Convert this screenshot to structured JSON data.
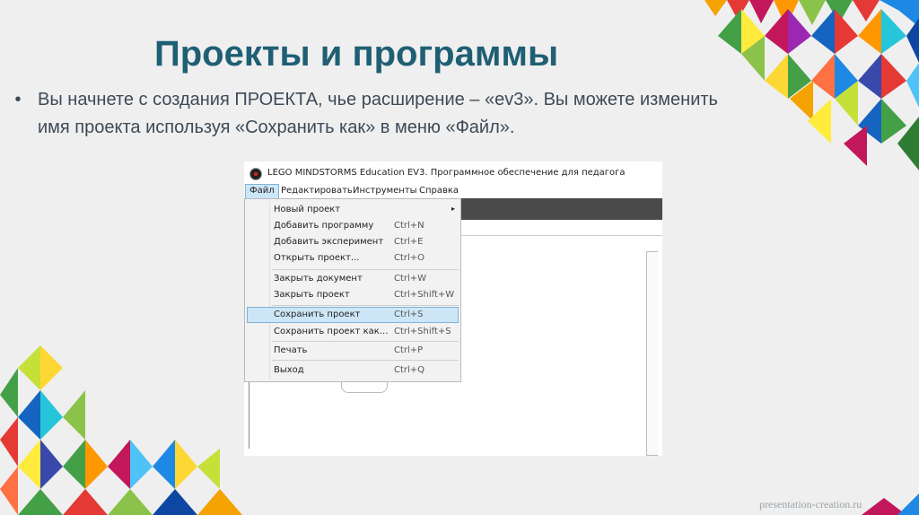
{
  "slide": {
    "title": "Проекты и программы",
    "bullet_marker": "•",
    "bullet_text": "Вы начнете с создания ПРОЕКТА, чье расширение – «ev3». Вы можете изменить имя проекта используя «Сохранить как» в меню «Файл».",
    "watermark": "presentation-creation.ru"
  },
  "screenshot": {
    "window_title": "LEGO MINDSTORMS Education EV3. Программное обеспечение для педагога",
    "menu": [
      {
        "label": "Файл",
        "active": true
      },
      {
        "label": "Редактировать",
        "active": false
      },
      {
        "label": "Инструменты",
        "active": false
      },
      {
        "label": "Справка",
        "active": false
      }
    ],
    "file_menu": [
      {
        "label": "Новый проект",
        "shortcut": "",
        "submenu": true
      },
      {
        "label": "Добавить программу",
        "shortcut": "Ctrl+N"
      },
      {
        "label": "Добавить эксперимент",
        "shortcut": "Ctrl+E"
      },
      {
        "label": "Открыть проект...",
        "shortcut": "Ctrl+O"
      },
      {
        "label": "Закрыть документ",
        "shortcut": "Ctrl+W"
      },
      {
        "label": "Закрыть проект",
        "shortcut": "Ctrl+Shift+W"
      },
      {
        "label": "Сохранить проект",
        "shortcut": "Ctrl+S",
        "highlighted": true
      },
      {
        "label": "Сохранить проект как...",
        "shortcut": "Ctrl+Shift+S"
      },
      {
        "label": "Печать",
        "shortcut": "Ctrl+P"
      },
      {
        "label": "Выход",
        "shortcut": "Ctrl+Q"
      }
    ],
    "submenu_arrow": "▸"
  },
  "colors": {
    "title": "#1f5f74",
    "menu_highlight": "#cde6f7"
  }
}
